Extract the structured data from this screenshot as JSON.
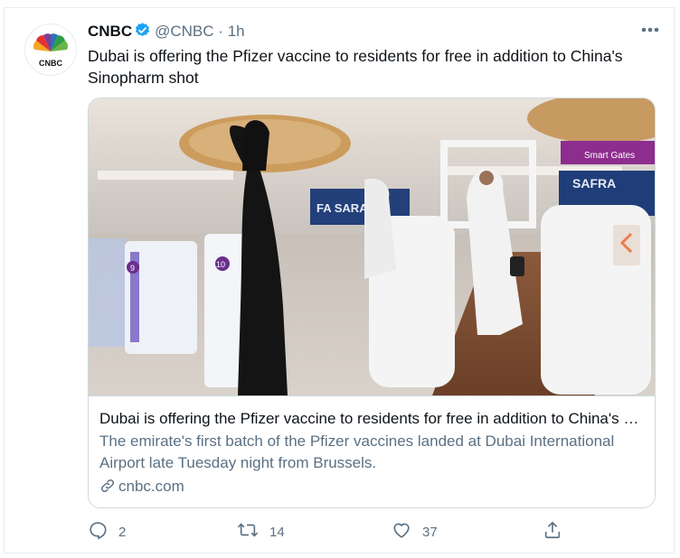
{
  "tweet": {
    "author_name": "CNBC",
    "handle": "@CNBC",
    "separator": "·",
    "time": "1h",
    "text": "Dubai is offering the Pfizer vaccine to residents for free in addition to China's Sinopharm shot",
    "avatar_icon": "cnbc-peacock-logo",
    "colors": {
      "brand_blue": "#1da1f2",
      "muted": "#5b7083"
    }
  },
  "card": {
    "title": "Dubai is offering the Pfizer vaccine to residents for free in addition to China's Sinopharm shot",
    "description": "The emirate's first batch of the Pfizer vaccines landed at Dubai International Airport late Tuesday night from Brussels.",
    "domain": "cnbc.com",
    "image_signs": {
      "gate_9": "9",
      "gate_10": "10",
      "banner": "SAFRA",
      "banner_left": "FA SARA",
      "smart_gates": "Smart Gates"
    }
  },
  "actions": {
    "reply_count": "2",
    "retweet_count": "14",
    "like_count": "37"
  }
}
